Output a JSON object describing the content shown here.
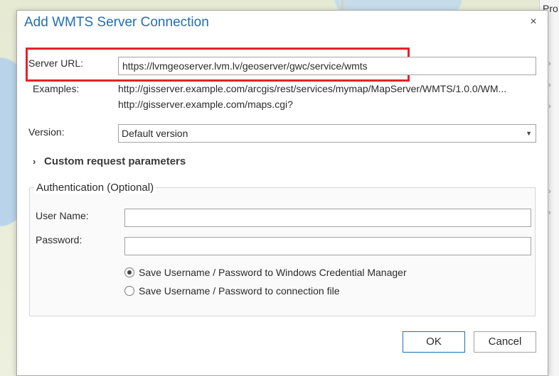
{
  "background": {
    "panel_title": "Pro",
    "panel_chevrons": [
      "›",
      "›",
      "›",
      "›",
      "›"
    ]
  },
  "dialog": {
    "title": "Add WMTS Server Connection",
    "close_icon": "×",
    "server_url_label": "Server URL:",
    "server_url_value": "https://lvmgeoserver.lvm.lv/geoserver/gwc/service/wmts",
    "examples_label": "Examples:",
    "examples": [
      "http://gisserver.example.com/arcgis/rest/services/mymap/MapServer/WMTS/1.0.0/WM...",
      "http://gisserver.example.com/maps.cgi?"
    ],
    "version_label": "Version:",
    "version_value": "Default version",
    "custom_params_label": "Custom request parameters",
    "auth_group_title": "Authentication (Optional)",
    "username_label": "User Name:",
    "username_value": "",
    "password_label": "Password:",
    "password_value": "",
    "radio_options": [
      {
        "label": "Save Username / Password to Windows Credential Manager",
        "checked": true
      },
      {
        "label": "Save Username / Password to connection file",
        "checked": false
      }
    ],
    "ok_label": "OK",
    "cancel_label": "Cancel"
  },
  "colors": {
    "title": "#1f6fb3",
    "highlight": "#e8202a"
  },
  "icons": {
    "close": "close-icon",
    "expander": "chevron-right-icon",
    "dropdown": "chevron-down-icon"
  }
}
